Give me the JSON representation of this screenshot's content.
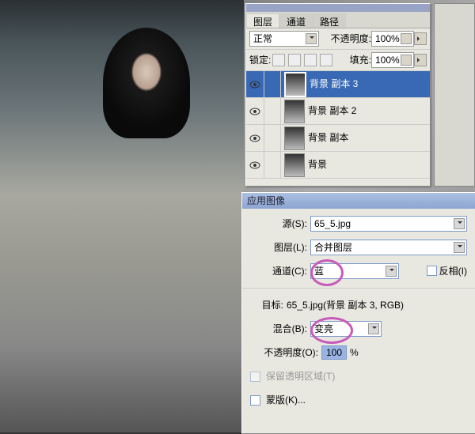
{
  "layers_panel": {
    "tabs": [
      "图层",
      "通道",
      "路径"
    ],
    "blend_mode": "正常",
    "opacity_label": "不透明度:",
    "opacity_value": "100%",
    "lock_label": "锁定:",
    "fill_label": "填充:",
    "fill_value": "100%",
    "items": [
      {
        "name": "背景 副本 3",
        "selected": true
      },
      {
        "name": "背景 副本 2",
        "selected": false
      },
      {
        "name": "背景 副本",
        "selected": false
      },
      {
        "name": "背景",
        "selected": false
      }
    ]
  },
  "dialog": {
    "title": "应用图像",
    "source_label": "源(S):",
    "source_value": "65_5.jpg",
    "layer_label": "图层(L):",
    "layer_value": "合并图层",
    "channel_label": "通道(C):",
    "channel_value": "蓝",
    "invert_label": "反相(I)",
    "target_label": "目标:",
    "target_value": "65_5.jpg(背景 副本 3, RGB)",
    "blend_label": "混合(B):",
    "blend_value": "变亮",
    "opacity_label": "不透明度(O):",
    "opacity_value": "100",
    "opacity_unit": "%",
    "preserve_trans_label": "保留透明区域(T)",
    "mask_label": "蒙版(K)..."
  }
}
